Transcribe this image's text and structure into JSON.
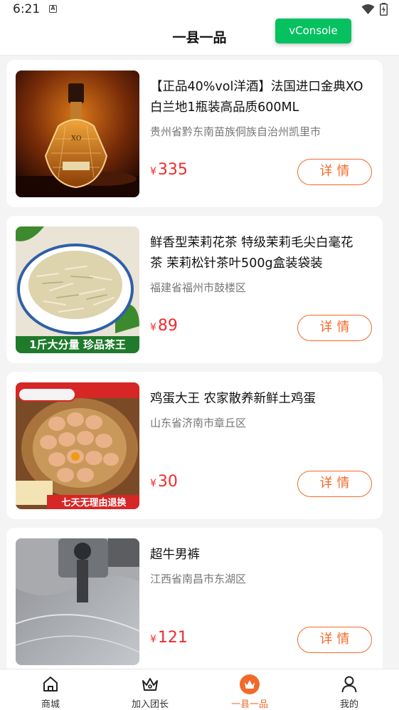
{
  "status_bar": {
    "time": "6:21",
    "notification_badge": "A"
  },
  "header": {
    "title": "一县一品",
    "vconsole_label": "vConsole"
  },
  "products": [
    {
      "title": "【正品40%vol洋酒】法国进口金典XO白兰地1瓶装高品质600ML",
      "region": "贵州省黔东南苗族侗族自治州凯里市",
      "currency": "¥",
      "price": "335",
      "detail_label": "详情",
      "image_icon": "brandy-bottle-image",
      "image_overlay": ""
    },
    {
      "title": "鲜香型茉莉花茶 特级茉莉毛尖白毫花茶 茉莉松针茶叶500g盒装袋装",
      "region": "福建省福州市鼓楼区",
      "currency": "¥",
      "price": "89",
      "detail_label": "详情",
      "image_icon": "jasmine-tea-image",
      "image_overlay": "1斤大分量 珍品茶王"
    },
    {
      "title": "鸡蛋大王 农家散养新鲜土鸡蛋",
      "region": "山东省济南市章丘区",
      "currency": "¥",
      "price": "30",
      "detail_label": "详情",
      "image_icon": "eggs-basket-image",
      "image_overlay": "七天无理由退换"
    },
    {
      "title": "超牛男裤",
      "region": "江西省南昌市东湖区",
      "currency": "¥",
      "price": "121",
      "detail_label": "详情",
      "image_icon": "sewing-machine-image",
      "image_overlay": ""
    }
  ],
  "tabbar": {
    "items": [
      {
        "label": "商城",
        "icon": "home-icon",
        "active": false
      },
      {
        "label": "加入团长",
        "icon": "crown-outline-icon",
        "active": false
      },
      {
        "label": "一县一品",
        "icon": "crown-filled-icon",
        "active": true
      },
      {
        "label": "我的",
        "icon": "user-icon",
        "active": false
      }
    ]
  },
  "colors": {
    "accent": "#f26a2a",
    "price": "#f12b2b",
    "vconsole": "#05c160"
  }
}
